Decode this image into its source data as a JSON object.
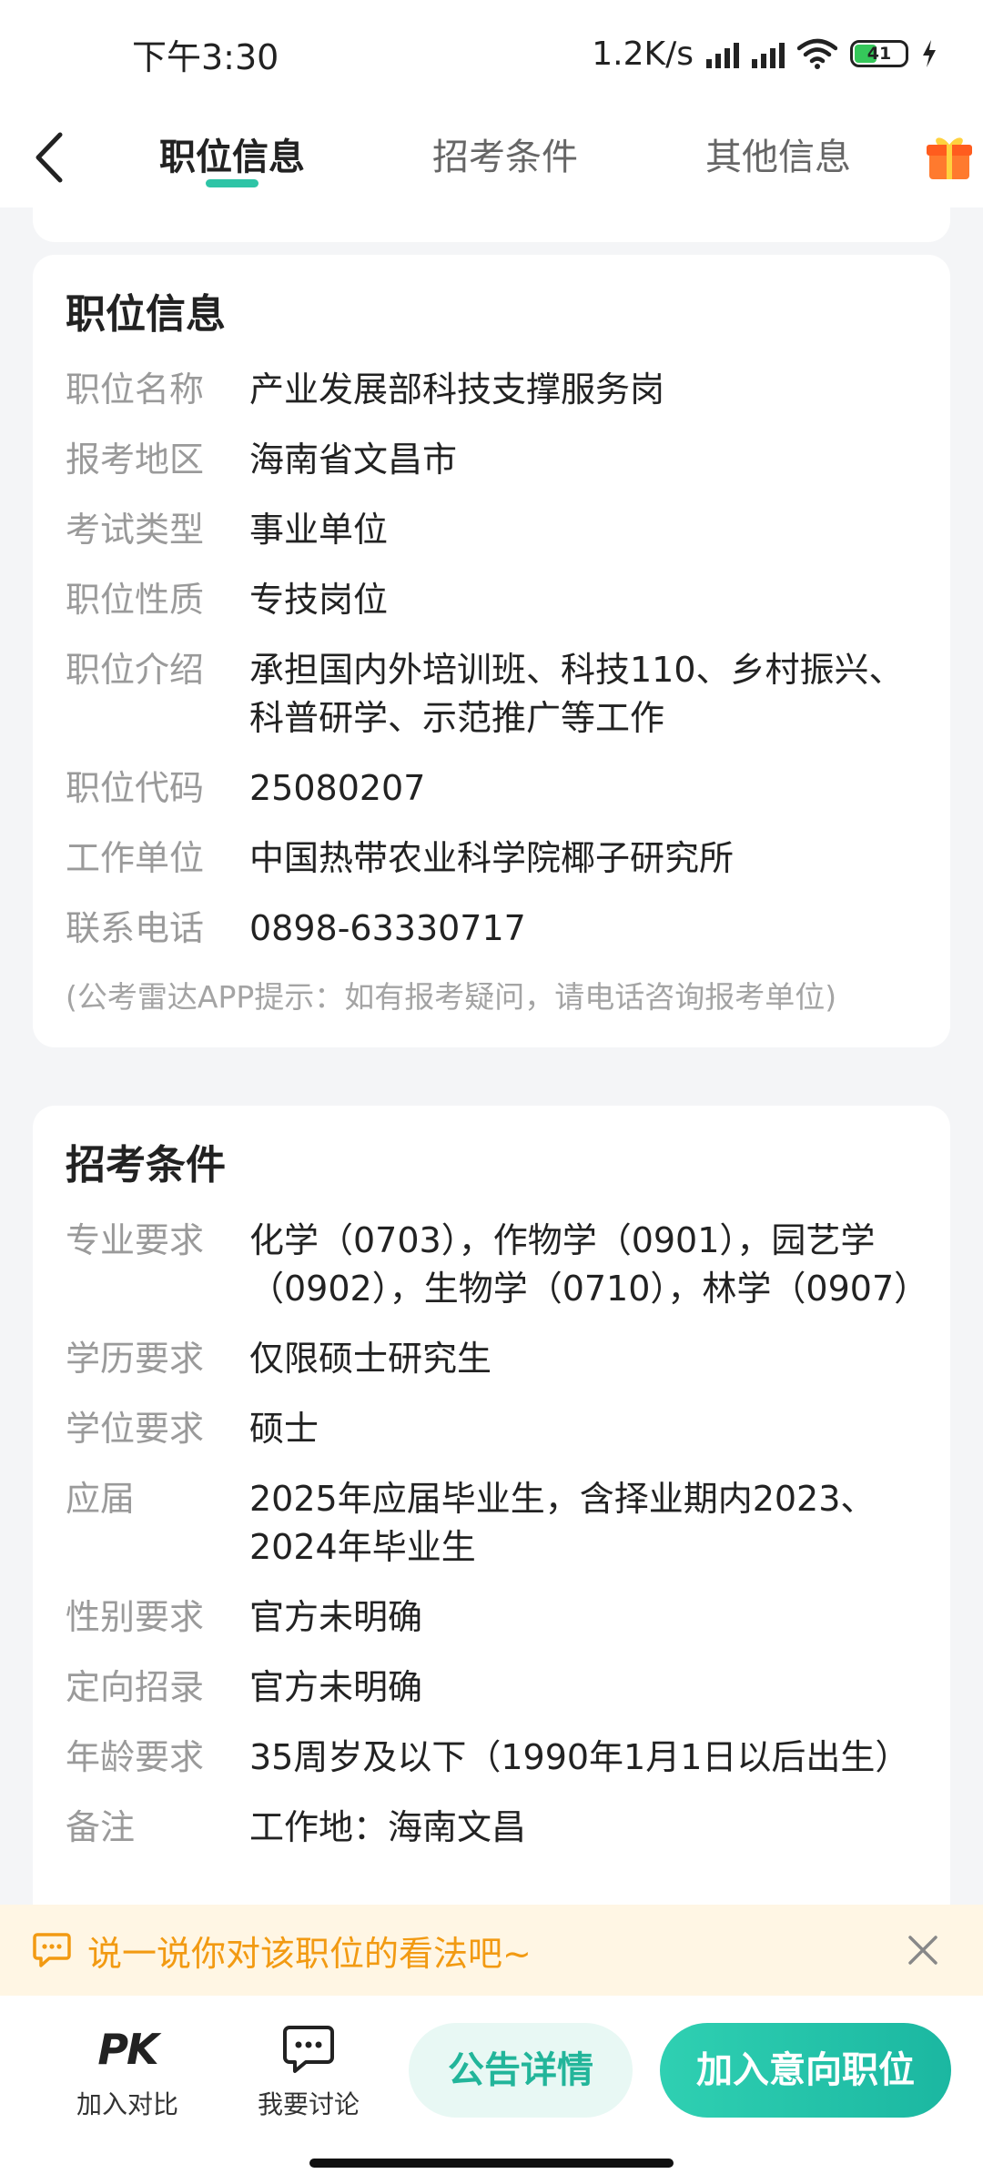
{
  "status_bar": {
    "time": "下午3:30",
    "network_speed": "1.2K/s",
    "battery": "41"
  },
  "nav": {
    "tabs": [
      {
        "label": "职位信息",
        "active": true
      },
      {
        "label": "招考条件",
        "active": false
      },
      {
        "label": "其他信息",
        "active": false
      }
    ]
  },
  "position_info": {
    "title": "职位信息",
    "rows": [
      {
        "label": "职位名称",
        "value": "产业发展部科技支撑服务岗"
      },
      {
        "label": "报考地区",
        "value": "海南省文昌市"
      },
      {
        "label": "考试类型",
        "value": "事业单位"
      },
      {
        "label": "职位性质",
        "value": "专技岗位"
      },
      {
        "label": "职位介绍",
        "value": "承担国内外培训班、科技110、乡村振兴、科普研学、示范推广等工作"
      },
      {
        "label": "职位代码",
        "value": "25080207"
      },
      {
        "label": "工作单位",
        "value": "中国热带农业科学院椰子研究所"
      },
      {
        "label": "联系电话",
        "value": "0898-63330717"
      }
    ],
    "tip": "(公考雷达APP提示：如有报考疑问，请电话咨询报考单位)"
  },
  "requirements": {
    "title": "招考条件",
    "rows": [
      {
        "label": "专业要求",
        "value": "化学（0703），作物学（0901），园艺学（0902），生物学（0710），林学（0907）"
      },
      {
        "label": "学历要求",
        "value": "仅限硕士研究生"
      },
      {
        "label": "学位要求",
        "value": "硕士"
      },
      {
        "label": "应届",
        "value": "2025年应届毕业生，含择业期内2023、2024年毕业生"
      },
      {
        "label": "性别要求",
        "value": "官方未明确"
      },
      {
        "label": "定向招录",
        "value": "官方未明确"
      },
      {
        "label": "年龄要求",
        "value": "35周岁及以下（1990年1月1日以后出生）"
      },
      {
        "label": "备注",
        "value": "工作地：海南文昌"
      }
    ]
  },
  "comment_banner": {
    "text": "说一说你对该职位的看法吧~"
  },
  "bottom_bar": {
    "compare_icon_text": "PK",
    "compare_label": "加入对比",
    "discuss_label": "我要讨论",
    "notice_label": "公告详情",
    "join_label": "加入意向职位"
  },
  "colors": {
    "accent": "#2ec4a6",
    "banner_text": "#f29a12",
    "banner_bg": "#fff6e4"
  }
}
